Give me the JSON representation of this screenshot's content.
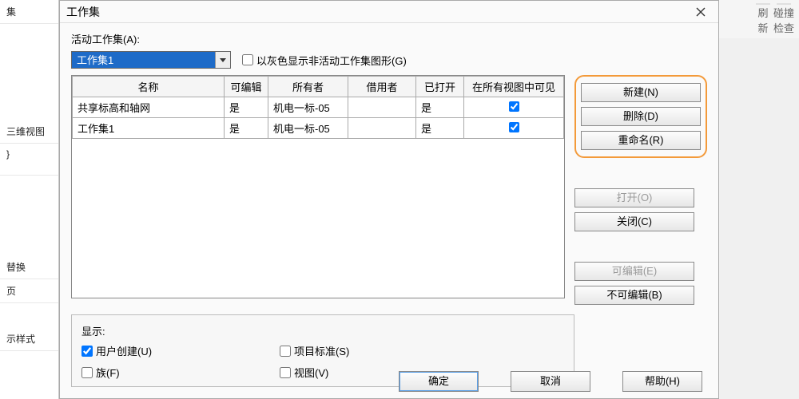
{
  "bg": {
    "sidebar": [
      "集",
      "",
      "三维视图",
      "}",
      "",
      "替换",
      "页",
      "",
      "示样式"
    ],
    "ribbon": [
      {
        "icon": "refresh",
        "l1": "刷",
        "l2": "新"
      },
      {
        "icon": "check",
        "l1": "碰撞",
        "l2": "检查"
      }
    ]
  },
  "dialog": {
    "title": "工作集",
    "active_label": "活动工作集(A):",
    "active_value": "工作集1",
    "gray_nonactive": {
      "label": "以灰色显示非活动工作集图形(G)",
      "checked": false
    },
    "table": {
      "headers": [
        "名称",
        "可编辑",
        "所有者",
        "借用者",
        "已打开",
        "在所有视图中可见"
      ],
      "rows": [
        {
          "name": "共享标高和轴网",
          "editable": "是",
          "owner": "机电一标-05",
          "borrower": "",
          "opened": "是",
          "visible": true
        },
        {
          "name": "工作集1",
          "editable": "是",
          "owner": "机电一标-05",
          "borrower": "",
          "opened": "是",
          "visible": true
        }
      ]
    },
    "side_buttons": {
      "new": "新建(N)",
      "delete": "删除(D)",
      "rename": "重命名(R)",
      "open": "打开(O)",
      "close": "关闭(C)",
      "editable": "可编辑(E)",
      "noneditable": "不可编辑(B)"
    },
    "display": {
      "title": "显示:",
      "user_created": {
        "label": "用户创建(U)",
        "checked": true
      },
      "families": {
        "label": "族(F)",
        "checked": false
      },
      "proj_std": {
        "label": "项目标准(S)",
        "checked": false
      },
      "views": {
        "label": "视图(V)",
        "checked": false
      }
    },
    "footer": {
      "ok": "确定",
      "cancel": "取消",
      "help": "帮助(H)"
    }
  }
}
